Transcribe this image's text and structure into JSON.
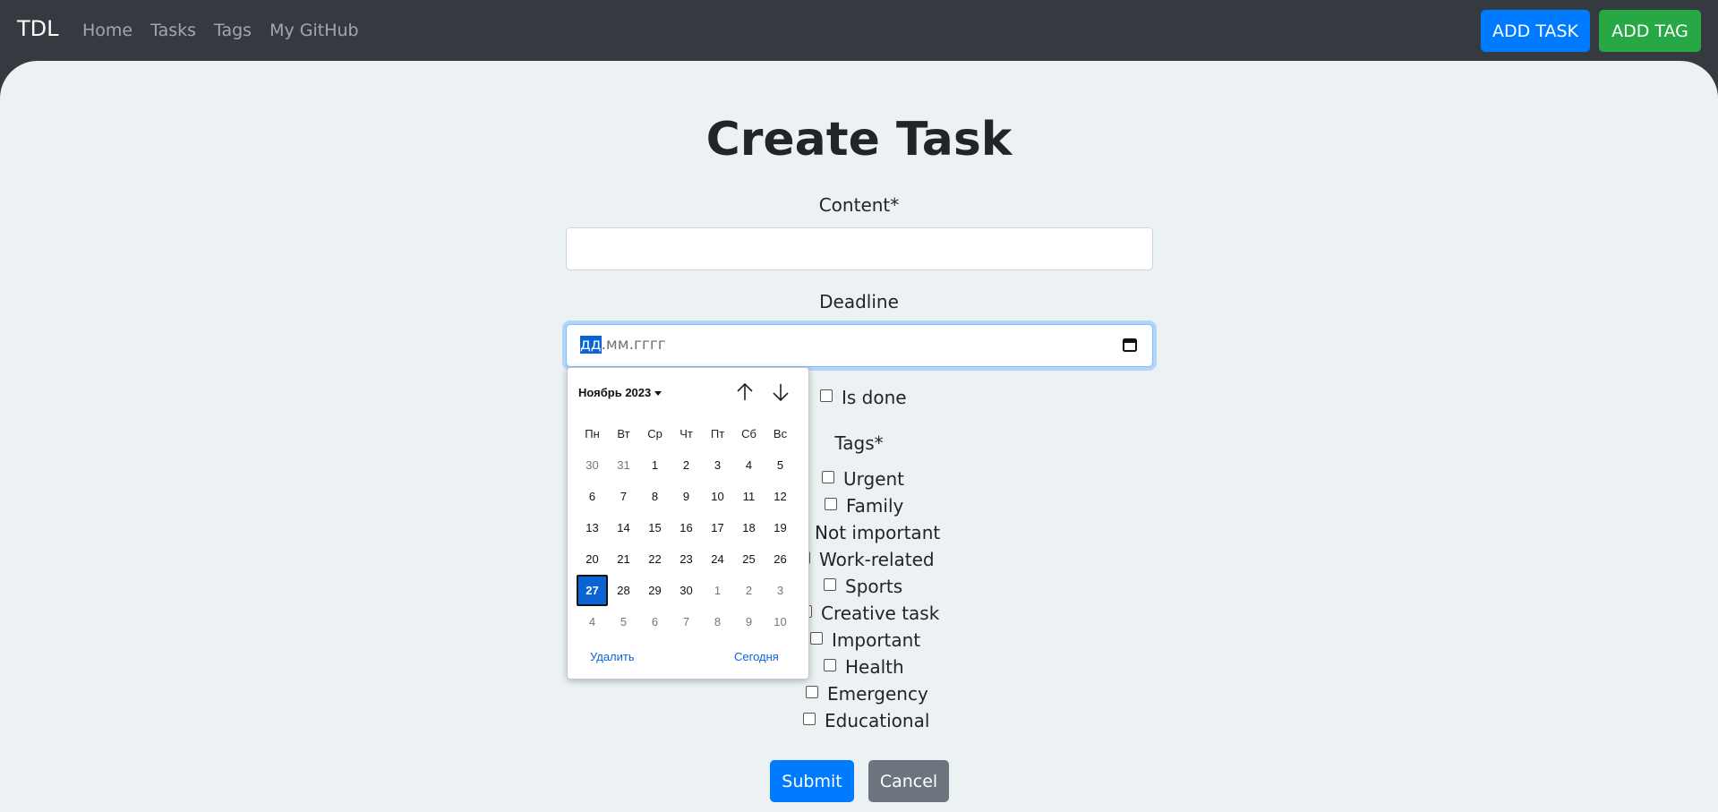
{
  "navbar": {
    "brand": "TDL",
    "links": [
      "Home",
      "Tasks",
      "Tags",
      "My GitHub"
    ],
    "add_task": "ADD TASK",
    "add_tag": "ADD TAG"
  },
  "form": {
    "title": "Create Task",
    "content_label": "Content*",
    "content_value": "",
    "deadline_label": "Deadline",
    "deadline_placeholder_day": "дд",
    "deadline_placeholder_rest": ".мм.гггг",
    "is_done_label": "Is done",
    "tags_label": "Tags*",
    "tags": [
      "Urgent",
      "Family",
      "Not important",
      "Work-related",
      "Sports",
      "Creative task",
      "Important",
      "Health",
      "Emergency",
      "Educational"
    ],
    "submit": "Submit",
    "cancel": "Cancel"
  },
  "calendar": {
    "month_label": "Ноябрь 2023",
    "weekdays": [
      "Пн",
      "Вт",
      "Ср",
      "Чт",
      "Пт",
      "Сб",
      "Вс"
    ],
    "days": [
      [
        "30",
        "31",
        "1",
        "2",
        "3",
        "4",
        "5"
      ],
      [
        "6",
        "7",
        "8",
        "9",
        "10",
        "11",
        "12"
      ],
      [
        "13",
        "14",
        "15",
        "16",
        "17",
        "18",
        "19"
      ],
      [
        "20",
        "21",
        "22",
        "23",
        "24",
        "25",
        "26"
      ],
      [
        "27",
        "28",
        "29",
        "30",
        "1",
        "2",
        "3"
      ],
      [
        "4",
        "5",
        "6",
        "7",
        "8",
        "9",
        "10"
      ]
    ],
    "selected_day": "27",
    "delete_label": "Удалить",
    "today_label": "Сегодня"
  },
  "colors": {
    "navbar_bg": "#343a40",
    "primary": "#007bff",
    "success": "#28a745",
    "secondary": "#6c757d",
    "page_bg": "#ecf2f4"
  }
}
